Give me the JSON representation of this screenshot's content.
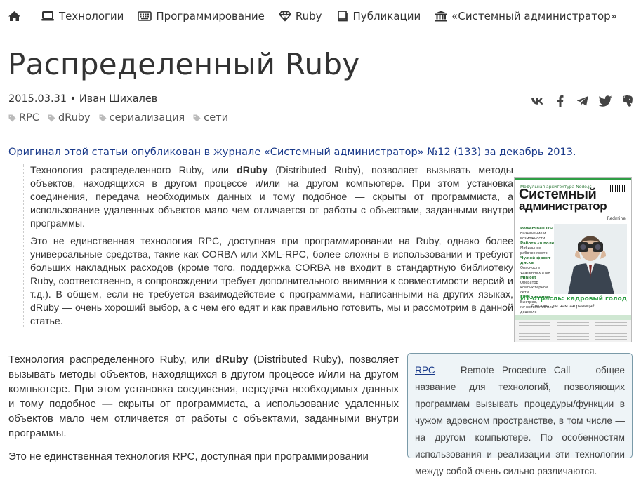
{
  "nav": {
    "home_icon": "home-icon",
    "items": [
      {
        "label": "Технологии",
        "icon": "laptop-icon"
      },
      {
        "label": "Программирование",
        "icon": "keyboard-icon"
      },
      {
        "label": "Ruby",
        "icon": "gem-icon"
      },
      {
        "label": "Публикации",
        "icon": "book-icon"
      },
      {
        "label": "«Системный администратор»",
        "icon": "institution-icon"
      }
    ]
  },
  "article": {
    "title": "Распределенный Ruby",
    "date": "2015.03.31",
    "separator": "•",
    "author": "Иван Шихалев",
    "tags": [
      "RPC",
      "dRuby",
      "сериализация",
      "сети"
    ],
    "share_icons": [
      "vk-icon",
      "facebook-icon",
      "telegram-icon",
      "twitter-icon",
      "evernote-icon"
    ],
    "notice": "Оригинал этой статьи опубликован в журнале «Системный администратор» №12 (133) за декабрь 2013.",
    "quote": {
      "p1_before": "Технология распределенного Ruby, или ",
      "p1_bold": "dRuby",
      "p1_after": " (Distributed Ruby), позволяет вызывать методы объектов, находящихся в другом процессе и/или на другом компьютере. При этом установка соединения, передача необходимых данных и тому подобное — скрыты от программиста, а использование удаленных объектов мало чем отличается от работы с объектами, заданными внутри программы.",
      "p2": "Это не единственная технология RPC, доступная при программировании на Ruby, однако более универсальные средства, такие как CORBA или XML-RPC, более сложны в использовании и требуют больших накладных расходов (кроме того, поддержка CORBA не входит в стандартную библиотеку Ruby, соответственно, в сопровождении требует дополнительного внимания к совместимости версий и т.д.). В общем, если не требуется взаимодействие с программами, написанными на других языках, dRuby — очень хороший выбор, а с чем его едят и как правильно готовить, мы и рассмотрим в данной статье."
    },
    "cover": {
      "kicker": "Модульная архитектура Node.js",
      "title_line1": "Системный",
      "title_line2": "администратор",
      "subtitle": "Redmine",
      "side_items": [
        {
          "head": "PowerShell DSC",
          "text": "Назначение и возможности"
        },
        {
          "head": "Работа «в поле»",
          "text": "Мобильное рабочее место"
        },
        {
          "head": "Чужой фронт диска",
          "text": "Опасность удаленных атак"
        },
        {
          "head": "Minicet",
          "text": "Оператор компьютерной сети"
        },
        {
          "head": "ERP-дилемма",
          "text": "Быстрее, качественнее или дешевле"
        }
      ],
      "headline": "ИТ-отрасль: кадровый голод",
      "headline_sub": "Покажет ли нам заграница?",
      "accent_color": "#2f9e45"
    },
    "main": {
      "p1_before": "Технология распределенного Ruby, или ",
      "p1_bold": "dRuby",
      "p1_after": " (Distributed Ruby), позволяет вызывать методы объектов, находящихся в другом процессе и/или на другом компьютере. При этом установка соединения, передача необходимых данных и тому подобное — скрыты от программиста, а использование удаленных объектов мало чем отличается от работы с объектами, заданными внутри программы.",
      "p2": "Это не единственная технология RPC, доступная при программировании"
    },
    "note": {
      "term": "RPC",
      "text": " — Remote Procedure Call — общее название для технологий, позволяющих программам вызывать процедуры/функции в чужом адресном пространстве, в том числе — на другом компьютере. По особенностям использования и реализации эти технологии между собой очень сильно различаются."
    }
  },
  "colors": {
    "text": "#333333",
    "link_blue": "#1a3a8a",
    "note_bg": "#eef4f7",
    "note_border": "#7a9aa8"
  }
}
